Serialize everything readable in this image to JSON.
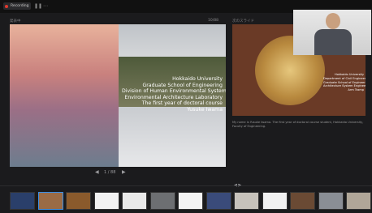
{
  "toolbar": {
    "rec_label": "Recording"
  },
  "panels": {
    "left_label": "発表中",
    "right_label": "次のスライド",
    "counter_top": "10/88",
    "counter_bottom": "1 / 88"
  },
  "main_slide": {
    "lines": [
      "Hokkaido University",
      "Graduate School of Engineering",
      "Division of Human Environmental System",
      "Environmental Architecture Laboratory",
      "The first year of doctoral course",
      "Yusuke Iwama"
    ]
  },
  "next_slide": {
    "lines": [
      "Hokkaido University",
      "Department of Civil Engineering",
      "Graduate School of Engineering",
      "Architecture System Engineering",
      "Arm Tramp"
    ],
    "caption": "My name is Yusuke Iwama. The first year of doctoral course student, Hokkaido University, Faculty of Engineering."
  },
  "thumbnails": [
    {
      "color": "#2a3f6a",
      "active": false
    },
    {
      "color": "#9a6b45",
      "active": true
    },
    {
      "color": "#8a5a2c",
      "active": false
    },
    {
      "color": "#f2f2f2",
      "active": false
    },
    {
      "color": "#e9e9e9",
      "active": false
    },
    {
      "color": "#6d6f72",
      "active": false
    },
    {
      "color": "#f4f4f4",
      "active": false
    },
    {
      "color": "#3a4b7a",
      "active": false
    },
    {
      "color": "#c7c2bb",
      "active": false
    },
    {
      "color": "#f1f1f1",
      "active": false
    },
    {
      "color": "#6a4a34",
      "active": false
    },
    {
      "color": "#8a8e95",
      "active": false
    },
    {
      "color": "#b0a698",
      "active": false
    }
  ]
}
